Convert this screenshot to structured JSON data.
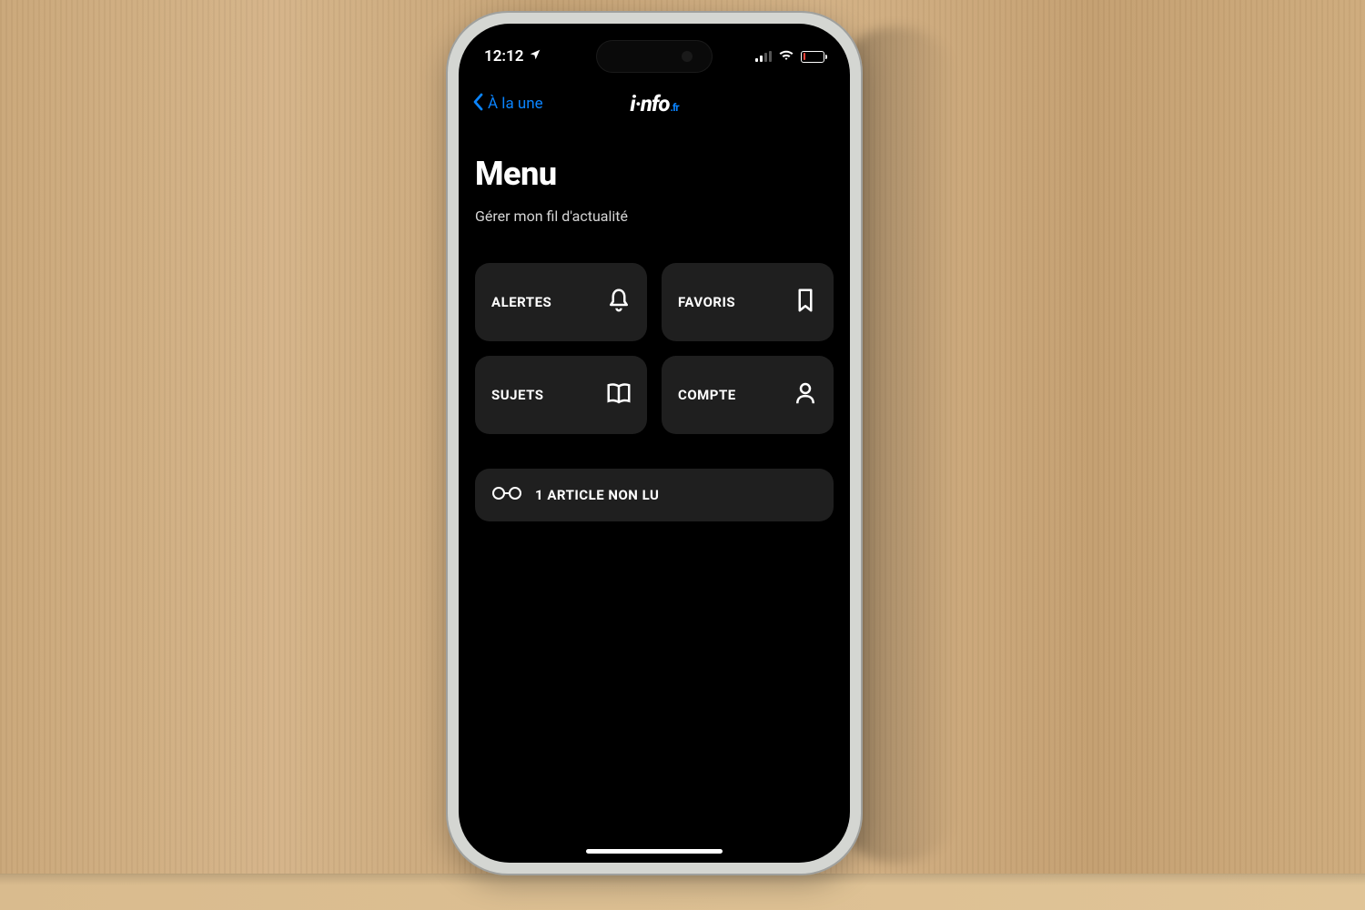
{
  "status": {
    "time": "12:12",
    "battery_level_percent": 12,
    "battery_color": "#ff453a"
  },
  "nav": {
    "back_label": "À la une",
    "brand_main": "i·nfo",
    "brand_suffix": ".fr"
  },
  "page": {
    "title": "Menu",
    "subtitle": "Gérer mon fil d'actualité"
  },
  "tiles": {
    "alerts": {
      "label": "ALERTES"
    },
    "favoris": {
      "label": "FAVORIS"
    },
    "sujets": {
      "label": "SUJETS"
    },
    "compte": {
      "label": "COMPTE"
    }
  },
  "unread": {
    "label": "1 ARTICLE NON LU"
  }
}
